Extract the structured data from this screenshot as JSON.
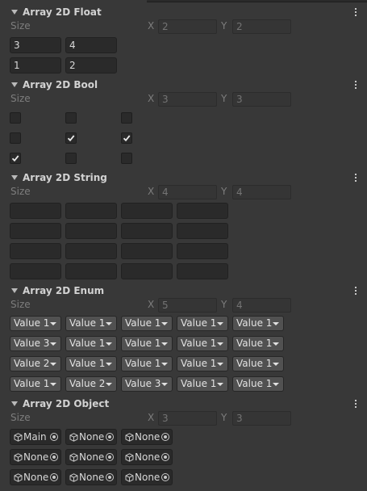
{
  "size_label": "Size",
  "x_label": "X",
  "y_label": "Y",
  "float_section": {
    "title": "Array 2D Float",
    "x": "2",
    "y": "2",
    "cells": [
      [
        "3",
        "4"
      ],
      [
        "1",
        "2"
      ]
    ]
  },
  "bool_section": {
    "title": "Array 2D Bool",
    "x": "3",
    "y": "3",
    "cells": [
      [
        false,
        false,
        false
      ],
      [
        false,
        true,
        true
      ],
      [
        true,
        false,
        false
      ]
    ]
  },
  "string_section": {
    "title": "Array 2D String",
    "x": "4",
    "y": "4",
    "cells": [
      [
        "",
        "",
        "",
        ""
      ],
      [
        "",
        "",
        "",
        ""
      ],
      [
        "",
        "",
        "",
        ""
      ],
      [
        "",
        "",
        "",
        ""
      ]
    ]
  },
  "enum_section": {
    "title": "Array 2D Enum",
    "x": "5",
    "y": "4",
    "cells": [
      [
        "Value 1",
        "Value 1",
        "Value 1",
        "Value 1",
        "Value 1"
      ],
      [
        "Value 3",
        "Value 1",
        "Value 1",
        "Value 1",
        "Value 1"
      ],
      [
        "Value 2",
        "Value 1",
        "Value 1",
        "Value 1",
        "Value 1"
      ],
      [
        "Value 1",
        "Value 2",
        "Value 3",
        "Value 1",
        "Value 1"
      ]
    ]
  },
  "object_section": {
    "title": "Array 2D Object",
    "x": "3",
    "y": "3",
    "cells": [
      [
        "Main",
        "None",
        "None"
      ],
      [
        "None",
        "None",
        "None"
      ],
      [
        "None",
        "None",
        "None"
      ]
    ]
  },
  "icons": {
    "foldout": "foldout-triangle-icon",
    "menu": "kebab-menu-icon",
    "check": "checkmark-icon",
    "object": "cube-icon",
    "picker": "object-picker-icon"
  }
}
